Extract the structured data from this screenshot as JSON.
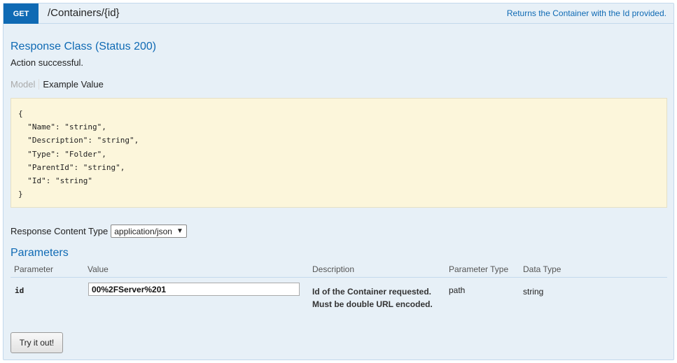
{
  "operation": {
    "method": "GET",
    "path": "/Containers/{id}",
    "summary": "Returns the Container with the Id provided."
  },
  "response": {
    "class_title": "Response Class (Status 200)",
    "message": "Action successful.",
    "tabs": {
      "model": "Model",
      "example": "Example Value"
    },
    "example_json": "{\n  \"Name\": \"string\",\n  \"Description\": \"string\",\n  \"Type\": \"Folder\",\n  \"ParentId\": \"string\",\n  \"Id\": \"string\"\n}"
  },
  "content_type": {
    "label": "Response Content Type",
    "selected": "application/json"
  },
  "parameters": {
    "title": "Parameters",
    "headers": {
      "parameter": "Parameter",
      "value": "Value",
      "description": "Description",
      "parameter_type": "Parameter Type",
      "data_type": "Data Type"
    },
    "rows": [
      {
        "name": "id",
        "value": "00%2FServer%201",
        "description": "Id of the Container requested. Must be double URL encoded.",
        "parameter_type": "path",
        "data_type": "string"
      }
    ]
  },
  "actions": {
    "try_label": "Try it out!"
  }
}
